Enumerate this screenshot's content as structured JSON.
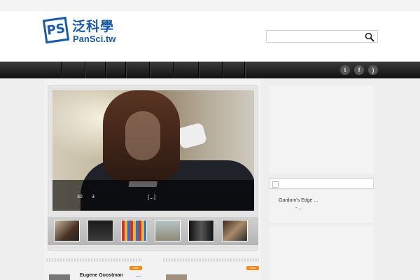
{
  "header": {
    "logo_mark": "PS",
    "logo_cn": "泛科學",
    "logo_en": "PanSci.tw",
    "search_placeholder": ""
  },
  "social": [
    "twitter-icon",
    "facebook-icon",
    "rss-icon"
  ],
  "slider": {
    "caption_num1": "30",
    "caption_num2": "3",
    "caption_more": "[...]"
  },
  "sidebar": {
    "item1": "Gardom's Edge ...",
    "item2": "- ..."
  },
  "posts": {
    "tag": "more",
    "title": "Eugene Goostman",
    "dash": "—"
  },
  "colors": {
    "brand": "#1a5aa6",
    "nav": "#1c1c1c",
    "tag": "#f08a1c"
  }
}
